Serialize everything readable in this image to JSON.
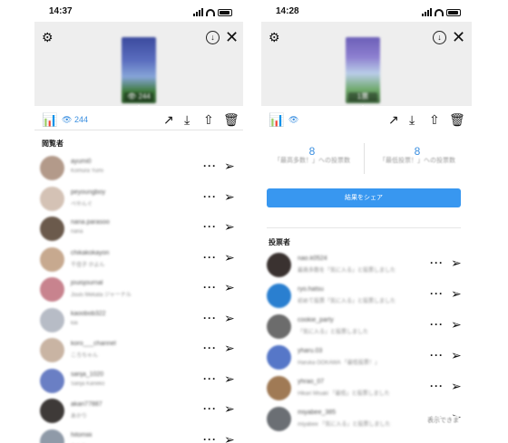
{
  "left": {
    "status_time": "14:37",
    "story_count": "244",
    "view_count": "244",
    "section_title": "閲覧者",
    "viewers": [
      {
        "name": "ayumi0",
        "sub": "Komura Yumi",
        "color": "#b39a8a"
      },
      {
        "name": "peyoungboy",
        "sub": "ぺやんぐ",
        "color": "#d4c2b5"
      },
      {
        "name": "nana.parasoo",
        "sub": "nana",
        "color": "#6b5a4c"
      },
      {
        "name": "chikakokayon",
        "sub": "千佳子 かよん",
        "color": "#c7a98f"
      },
      {
        "name": "jouisjournal",
        "sub": "Jouis Mekata ジャーナル",
        "color": "#c8838e"
      },
      {
        "name": "kaoobob322",
        "sub": "kai",
        "color": "#b7bcc6"
      },
      {
        "name": "koro___channel",
        "sub": "ころちゃん",
        "color": "#c9b4a3"
      },
      {
        "name": "sanja_1020",
        "sub": "Sanja Kaneko",
        "color": "#6a7fc4"
      },
      {
        "name": "akari77887",
        "sub": "あかり",
        "color": "#3e3a38"
      },
      {
        "name": "hitomiiii",
        "sub": "ひとみ",
        "color": "#8f9aa8"
      }
    ]
  },
  "right": {
    "status_time": "14:28",
    "story_badge": "1票",
    "stat1": {
      "number": "8",
      "label": "「最高多数！」への投票数"
    },
    "stat2": {
      "number": "8",
      "label": "「最低投票！」への投票数"
    },
    "share_label": "結果をシェア",
    "section_title": "投票者",
    "voters": [
      {
        "name": "nao.k0524",
        "sub": "最高多数を「気に入る」と投票しました",
        "color": "#3a3230"
      },
      {
        "name": "ryo.hatsu",
        "sub": "初めて投票「気に入る」と投票しました",
        "color": "#2a7fd0"
      },
      {
        "name": "cookie_party",
        "sub": "「気に入る」と投票しました",
        "color": "#6c6c6c"
      },
      {
        "name": "yharu.03",
        "sub": "Haruka OOKAWA 「最低投票！」",
        "color": "#5677c8"
      },
      {
        "name": "yhrao_07",
        "sub": "Hikari Misaki 「最低」と投票しました",
        "color": "#a07a55"
      },
      {
        "name": "miyabee_385",
        "sub": "miyabee 「気に入る」と投票しました",
        "color": "#6b6f74"
      }
    ],
    "overlay_note": "表示できま"
  }
}
